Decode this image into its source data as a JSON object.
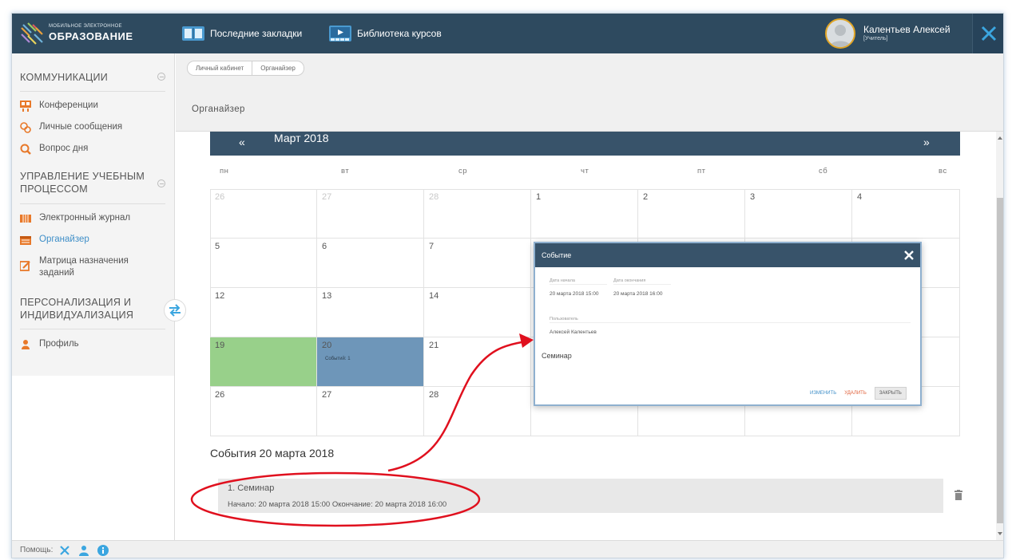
{
  "header": {
    "logo_small": "Мобильное электронное",
    "logo_big": "ОБРАЗОВАНИЕ",
    "nav": [
      {
        "label": "Последние закладки",
        "icon": "book-icon"
      },
      {
        "label": "Библиотека курсов",
        "icon": "video-library-icon"
      }
    ],
    "user": {
      "name": "Калентьев Алексей",
      "role": "[Учитель]"
    },
    "colors": {
      "topbar": "#2e4a5f",
      "accent": "#3f8fc8"
    }
  },
  "sidebar": {
    "sections": [
      {
        "title": "КОММУНИКАЦИИ",
        "items": [
          {
            "label": "Конференции",
            "icon": "conference-icon"
          },
          {
            "label": "Личные сообщения",
            "icon": "messages-icon"
          },
          {
            "label": "Вопрос дня",
            "icon": "search-question-icon"
          }
        ]
      },
      {
        "title": "УПРАВЛЕНИЕ УЧЕБНЫМ ПРОЦЕССОМ",
        "items": [
          {
            "label": "Электронный журнал",
            "icon": "journal-icon"
          },
          {
            "label": "Органайзер",
            "icon": "calendar-icon",
            "active": true
          },
          {
            "label": "Матрица назначения заданий",
            "icon": "edit-matrix-icon"
          }
        ]
      },
      {
        "title": "ПЕРСОНАЛИЗАЦИЯ И ИНДИВИДУАЛИЗАЦИЯ",
        "items": [
          {
            "label": "Профиль",
            "icon": "person-icon"
          }
        ]
      }
    ]
  },
  "breadcrumb": [
    "Личный кабинет",
    "Органайзер"
  ],
  "page_title": "Органайзер",
  "calendar": {
    "prev": "«",
    "month": "Март 2018",
    "next": "»",
    "weekdays": [
      "пн",
      "вт",
      "ср",
      "чт",
      "пт",
      "сб",
      "вс"
    ],
    "weeks": [
      [
        {
          "d": "26",
          "muted": true
        },
        {
          "d": "27",
          "muted": true
        },
        {
          "d": "28",
          "muted": true
        },
        {
          "d": "1"
        },
        {
          "d": "2"
        },
        {
          "d": "3"
        },
        {
          "d": "4"
        }
      ],
      [
        {
          "d": "5"
        },
        {
          "d": "6"
        },
        {
          "d": "7"
        },
        {
          "d": ""
        },
        {
          "d": ""
        },
        {
          "d": ""
        },
        {
          "d": ""
        }
      ],
      [
        {
          "d": "12"
        },
        {
          "d": "13"
        },
        {
          "d": "14"
        },
        {
          "d": ""
        },
        {
          "d": ""
        },
        {
          "d": ""
        },
        {
          "d": ""
        }
      ],
      [
        {
          "d": "19",
          "style": "green"
        },
        {
          "d": "20",
          "style": "blue",
          "event": "Событий: 1"
        },
        {
          "d": "21"
        },
        {
          "d": ""
        },
        {
          "d": ""
        },
        {
          "d": ""
        },
        {
          "d": ""
        }
      ],
      [
        {
          "d": "26"
        },
        {
          "d": "27"
        },
        {
          "d": "28"
        },
        {
          "d": ""
        },
        {
          "d": ""
        },
        {
          "d": ""
        },
        {
          "d": ""
        }
      ]
    ]
  },
  "events": {
    "title": "События 20 марта 2018",
    "items": [
      {
        "name": "1. Семинар",
        "times": "Начало: 20 марта 2018 15:00 Окончание: 20 марта 2018 16:00"
      }
    ]
  },
  "modal": {
    "title": "Событие",
    "start_label": "Дата начала",
    "end_label": "Дата окончания",
    "start_value": "20 марта 2018 15:00",
    "end_value": "20 марта 2018 16:00",
    "users_label": "Пользователь",
    "users_value": "Алексей Калентьев",
    "body": "Семинар",
    "btn_change": "ИЗМЕНИТЬ",
    "btn_delete": "УДАЛИТЬ",
    "btn_close": "ЗАКРЫТЬ"
  },
  "footer": {
    "label": "Помощь:",
    "icons": [
      "tools-icon",
      "user-help-icon",
      "info-icon"
    ]
  }
}
